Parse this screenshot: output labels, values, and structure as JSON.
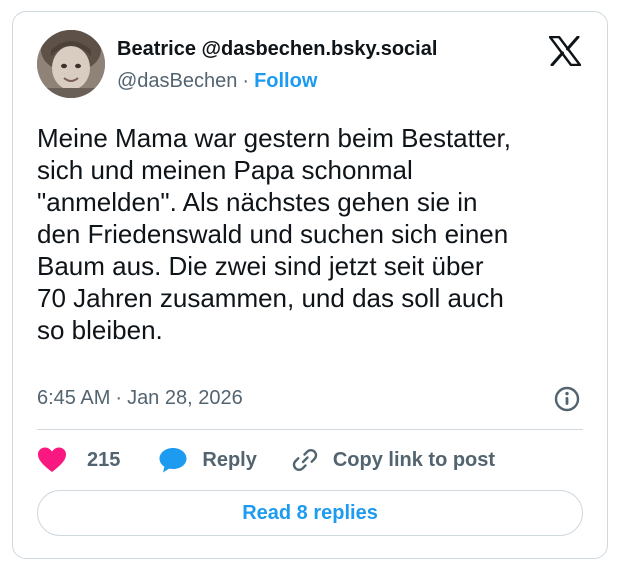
{
  "author": {
    "display_name": "Beatrice @dasbechen.bsky.social",
    "handle": "@dasBechen",
    "separator": "·",
    "follow_label": "Follow"
  },
  "post": {
    "text": "Meine Mama war gestern beim Bestatter,\nsich und meinen Papa schonmal\n\"anmelden\". Als nächstes gehen sie in\nden Friedenswald und suchen sich einen\nBaum aus. Die zwei sind jetzt seit über\n70 Jahren zusammen, und das soll auch\nso bleiben.",
    "time": "6:45 AM",
    "separator": "·",
    "date": "Jan 28, 2026"
  },
  "actions": {
    "like_count": "215",
    "reply_label": "Reply",
    "copy_label": "Copy link to post"
  },
  "read_replies_label": "Read 8 replies",
  "icons": {
    "platform": "x-logo-icon",
    "info": "info-icon",
    "like": "heart-icon",
    "reply": "speech-bubble-icon",
    "copy": "link-icon"
  },
  "colors": {
    "accent": "#1d9bf0",
    "like": "#f91880",
    "text": "#0f1419",
    "muted": "#536471",
    "border": "#cfd9de"
  }
}
